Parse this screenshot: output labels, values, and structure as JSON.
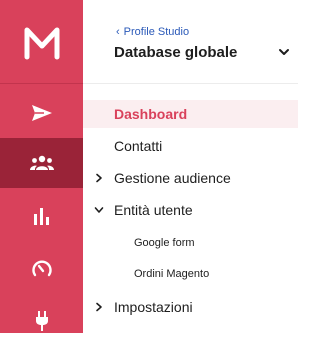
{
  "rail": {
    "brand_icon": "m-logo-icon",
    "colors": {
      "background": "#d9415b",
      "active": "#9a2338"
    },
    "items": [
      {
        "icon": "send-icon",
        "active": false
      },
      {
        "icon": "audience-icon",
        "active": true
      },
      {
        "icon": "bar-chart-icon",
        "active": false
      },
      {
        "icon": "gauge-icon",
        "active": false
      },
      {
        "icon": "plug-icon",
        "active": false
      }
    ]
  },
  "panel": {
    "breadcrumb": "Profile Studio",
    "title": "Database globale",
    "nav": [
      {
        "label": "Dashboard",
        "active": true,
        "expander": "none"
      },
      {
        "label": "Contatti",
        "active": false,
        "expander": "none"
      },
      {
        "label": "Gestione audience",
        "active": false,
        "expander": "collapsed"
      },
      {
        "label": "Entità utente",
        "active": false,
        "expander": "expanded"
      },
      {
        "label": "Google form",
        "active": false,
        "sub": true
      },
      {
        "label": "Ordini Magento",
        "active": false,
        "sub": true
      },
      {
        "label": "Impostazioni",
        "active": false,
        "expander": "collapsed"
      }
    ],
    "accent_color": "#d9415b",
    "link_color": "#2a59b8"
  }
}
